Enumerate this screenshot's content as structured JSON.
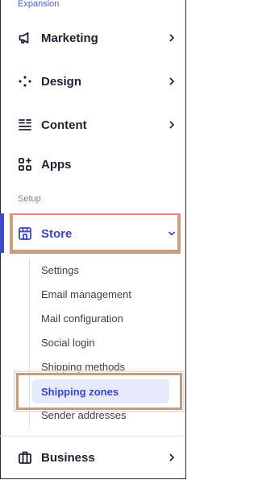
{
  "sections": {
    "expansion_label": "Expansion",
    "setup_label": "Setup"
  },
  "nav": {
    "marketing": "Marketing",
    "design": "Design",
    "content": "Content",
    "apps": "Apps",
    "store": "Store",
    "business": "Business"
  },
  "store_submenu": {
    "settings": "Settings",
    "email_management": "Email management",
    "mail_configuration": "Mail configuration",
    "social_login": "Social login",
    "shipping_methods": "Shipping methods",
    "shipping_zones": "Shipping zones",
    "sender_addresses": "Sender addresses"
  },
  "colors": {
    "accent": "#3a45c0",
    "active_bar": "#3d49c8",
    "highlight_bg": "#e6eafc",
    "annotation_pink": "#e57d86",
    "annotation_tan": "#c59d79"
  },
  "icons": {
    "marketing": "megaphone-icon",
    "design": "sparkle-dots-icon",
    "content": "list-text-icon",
    "apps": "apps-grid-icon",
    "store": "storefront-icon",
    "business": "briefcase-icon",
    "chevron_right": "chevron-right-icon",
    "chevron_down": "chevron-down-icon"
  }
}
